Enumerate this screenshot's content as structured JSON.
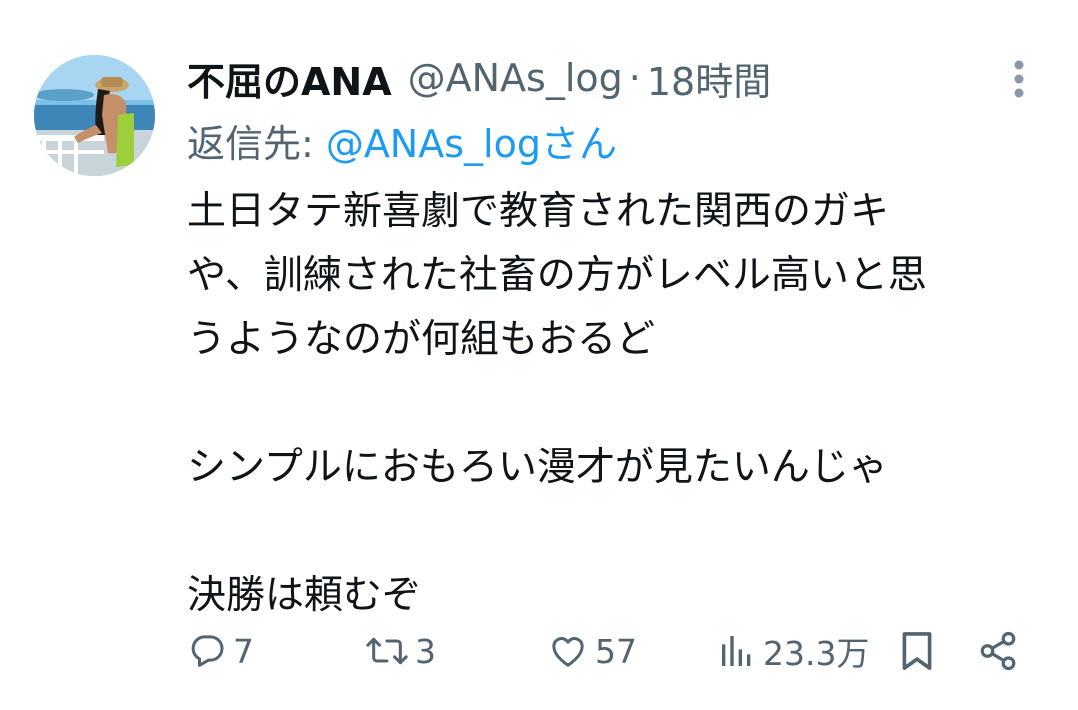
{
  "tweet": {
    "display_name": "不屈のANA",
    "handle": "@ANAs_log",
    "separator": "·",
    "time": "18時間",
    "reply_prefix": "返信先:",
    "reply_handle": "@ANAs_logさん",
    "body_lines": [
      "土日タテ新喜劇で教育された関西のガキ",
      "や、訓練された社畜の方がレベル高いと思",
      "うようなのが何組もおるど",
      "",
      "シンプルにおもろい漫才が見たいんじゃ",
      "",
      "決勝は頼むぞ"
    ]
  },
  "actions": {
    "reply_count": "7",
    "retweet_count": "3",
    "like_count": "57",
    "view_count": "23.3万"
  },
  "icons": {
    "more": "more-vertical-icon",
    "reply": "reply-icon",
    "retweet": "retweet-icon",
    "like": "heart-icon",
    "views": "views-chart-icon",
    "bookmark": "bookmark-icon",
    "share": "share-icon"
  },
  "colors": {
    "text": "#0f1419",
    "secondary": "#536471",
    "link": "#1d9bf0"
  }
}
